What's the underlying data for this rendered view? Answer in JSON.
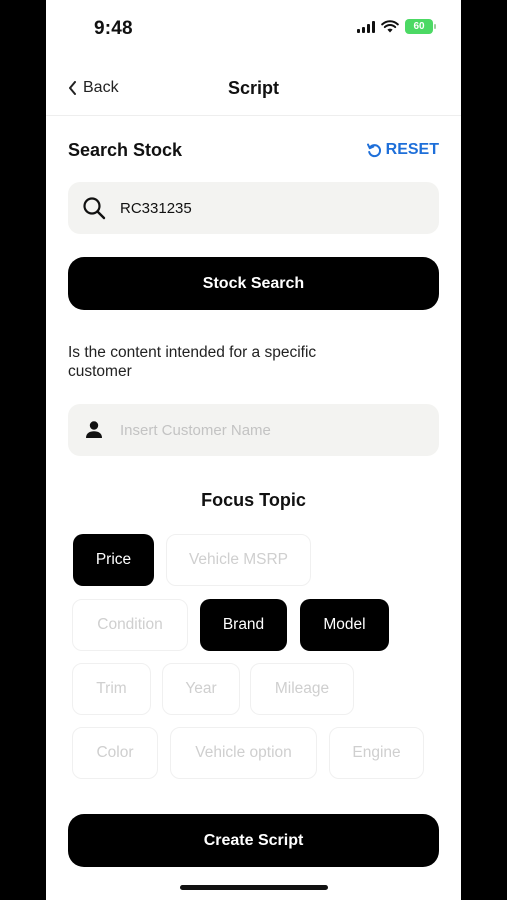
{
  "status_bar": {
    "time": "9:48",
    "battery": "60"
  },
  "header": {
    "back_label": "Back",
    "title": "Script"
  },
  "search_stock": {
    "title": "Search Stock",
    "reset_label": "RESET",
    "search_value": "RC331235",
    "button_label": "Stock Search"
  },
  "customer": {
    "question": "Is the content intended for a specific customer",
    "placeholder": "Insert Customer Name"
  },
  "focus_topic": {
    "title": "Focus Topic",
    "chips": [
      {
        "label": "Price",
        "selected": true
      },
      {
        "label": "Vehicle MSRP",
        "selected": false
      },
      {
        "label": "Condition",
        "selected": false
      },
      {
        "label": "Brand",
        "selected": true
      },
      {
        "label": "Model",
        "selected": true
      },
      {
        "label": "Trim",
        "selected": false
      },
      {
        "label": "Year",
        "selected": false
      },
      {
        "label": "Mileage",
        "selected": false
      },
      {
        "label": "Color",
        "selected": false
      },
      {
        "label": "Vehicle option",
        "selected": false
      },
      {
        "label": "Engine",
        "selected": false
      }
    ]
  },
  "create_button_label": "Create Script",
  "colors": {
    "accent": "#1e6fd9",
    "battery": "#4cd964",
    "field_bg": "#f3f3f1"
  }
}
